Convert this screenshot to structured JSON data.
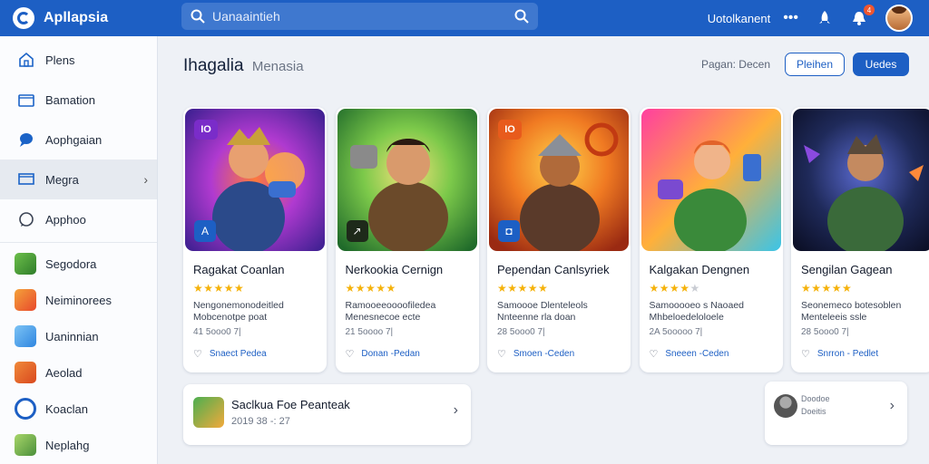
{
  "header": {
    "brand": "Apllapsia",
    "search_placeholder": "Uanaaintieh",
    "username": "Uotolkanent",
    "notification_count": "4"
  },
  "sidebar": {
    "nav": [
      {
        "label": "Plens",
        "icon": "home-icon"
      },
      {
        "label": "Bamation",
        "icon": "folder-icon"
      },
      {
        "label": "Aophgaian",
        "icon": "chat-icon"
      },
      {
        "label": "Megra",
        "icon": "monitor-icon",
        "active": true
      },
      {
        "label": "Apphoo",
        "icon": "message-icon"
      }
    ],
    "apps": [
      {
        "label": "Segodora",
        "color": "#6cbf4a"
      },
      {
        "label": "Neiminorees",
        "color": "#e8492c"
      },
      {
        "label": "Uaninnian",
        "color": "#2f86e0"
      },
      {
        "label": "Aeolad",
        "color": "#d9481e"
      },
      {
        "label": "Koaclan",
        "color": "#1d5fc4"
      },
      {
        "label": "Neplahg",
        "color": "#4b8f3a"
      }
    ]
  },
  "main": {
    "title": "Ihagalia",
    "subtitle": "Menasia",
    "filter_label": "Pagan: Decen",
    "outline_button": "Pleihen",
    "primary_button": "Uedes",
    "cards": [
      {
        "title": "Ragakat Coanlan",
        "rating": 5,
        "desc": "Nengonemonodeitled Mobcenotpe poat",
        "meta": "41 5ooo0 7|",
        "link": "Snaect Pedea",
        "badge": "IO",
        "corner": "A"
      },
      {
        "title": "Nerkookia Cernign",
        "rating": 5,
        "desc": "Ramooeeoooofiledea Menesnecoe ecte",
        "meta": "21 5oooo 7|",
        "link": "Donan -Pedan",
        "badge": "",
        "corner": "↗"
      },
      {
        "title": "Pependan Canlsyriek",
        "rating": 5,
        "desc": "Samoooe Dlenteleols Nnteenne rla doan",
        "meta": "28 5ooo0 7|",
        "link": "Smoen -Ceden",
        "badge": "IO",
        "corner": "◘"
      },
      {
        "title": "Kalgakan Dengnen",
        "rating": 4,
        "desc": "Samooooeo s Naoaed Mhbeloedeloloele",
        "meta": "2A 5ooooo 7|",
        "link": "Sneeen -Ceden",
        "badge": "",
        "corner": ""
      },
      {
        "title": "Sengilan Gagean",
        "rating": 5,
        "desc": "Seonemeco botesoblen Menteleeis ssle",
        "meta": "28 5ooo0 7|",
        "link": "Snrron - Pedlet",
        "badge": "",
        "corner": ""
      }
    ],
    "featured": {
      "title": "Saclkua Foe Peanteak",
      "meta": "2019 38 -: 27"
    },
    "mini": {
      "line1": "Doodoe",
      "line2": "Doeitis"
    }
  }
}
